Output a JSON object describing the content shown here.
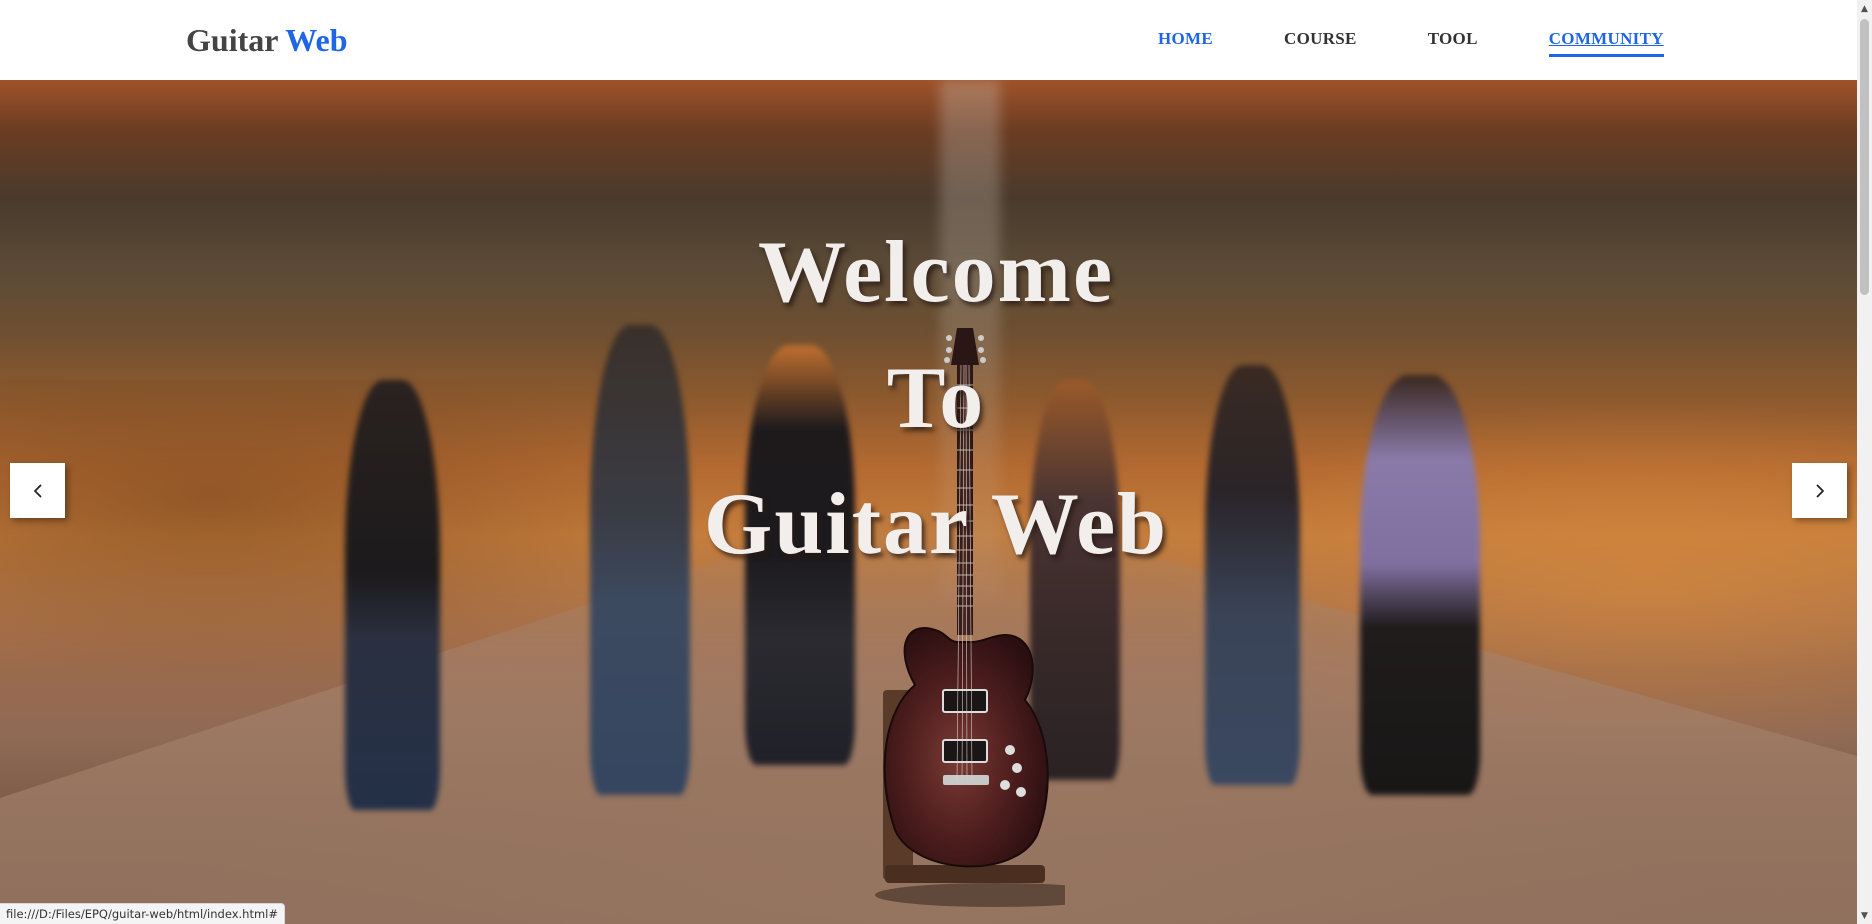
{
  "header": {
    "logo_prefix": "Guitar",
    "logo_accent": "Web",
    "nav": [
      {
        "label": "HOME",
        "state": "active"
      },
      {
        "label": "COURSE",
        "state": "normal"
      },
      {
        "label": "TOOL",
        "state": "normal"
      },
      {
        "label": "COMMUNITY",
        "state": "hover"
      }
    ]
  },
  "hero": {
    "title_lines": [
      "Welcome",
      "To",
      "Guitar Web"
    ],
    "prev_icon": "chevron-left-icon",
    "next_icon": "chevron-right-icon"
  },
  "status_bar": {
    "url": "file:///D:/Files/EPQ/guitar-web/html/index.html#"
  },
  "scrollbar": {
    "up_icon": "scroll-up-arrow-icon",
    "down_icon": "scroll-down-arrow-icon"
  },
  "colors": {
    "accent": "#1e66e6",
    "nav_text": "#333333",
    "logo_text": "#444444",
    "hero_title": "#f2eeec"
  }
}
